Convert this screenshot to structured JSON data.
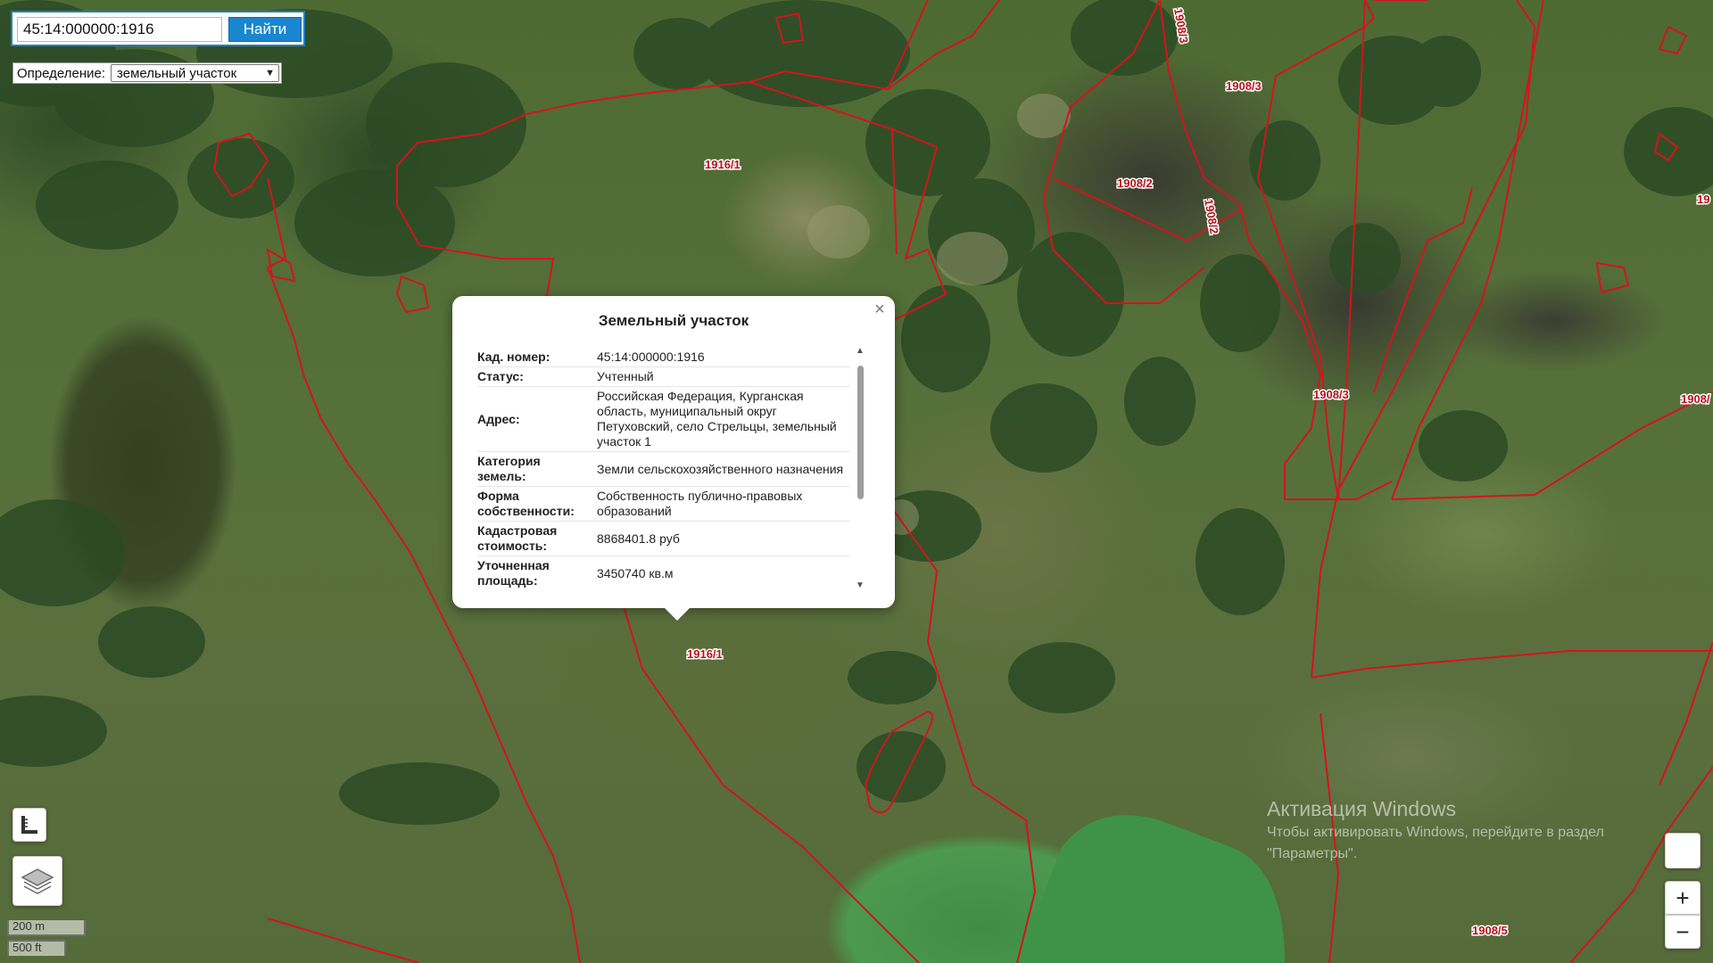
{
  "search": {
    "value": "45:14:000000:1916",
    "button_label": "Найти"
  },
  "definition": {
    "label": "Определение:",
    "selected": "земельный участок"
  },
  "popup": {
    "title": "Земельный участок",
    "close_glyph": "×",
    "rows": [
      {
        "key": "Кад. номер",
        "value": "45:14:000000:1916"
      },
      {
        "key": "Статус",
        "value": "Учтенный"
      },
      {
        "key": "Адрес",
        "value": "Российская Федерация, Курганская область, муниципальный округ Петуховский, село Стрельцы, земельный участок 1"
      },
      {
        "key": "Категория земель",
        "value": "Земли сельскохозяйственного назначения"
      },
      {
        "key": "Форма собственности",
        "value": "Собственность публично-правовых образований"
      },
      {
        "key": "Кадастровая стоимость",
        "value": "8868401.8 руб"
      },
      {
        "key": "Уточненная площадь",
        "value": "3450740 кв.м"
      }
    ]
  },
  "parcel_labels": [
    "1916/1",
    "1916/1",
    "1908/3",
    "1908/3",
    "1908/3",
    "1908/2",
    "1908/2",
    "1908/5",
    "1908/",
    "19"
  ],
  "scale": {
    "metric": "200 m",
    "imperial": "500 ft"
  },
  "zoom": {
    "in": "+",
    "out": "−"
  },
  "watermark": {
    "title": "Активация Windows",
    "text": "Чтобы активировать Windows, перейдите в раздел \"Параметры\"."
  },
  "icons": {
    "measure": "ruler-icon",
    "layers": "layers-icon",
    "close": "close-icon",
    "dropdown": "chevron-down-icon"
  },
  "colors": {
    "parcel_boundary": "#d3141c",
    "button_blue": "#1a86d0",
    "label_red": "#b4121b"
  }
}
